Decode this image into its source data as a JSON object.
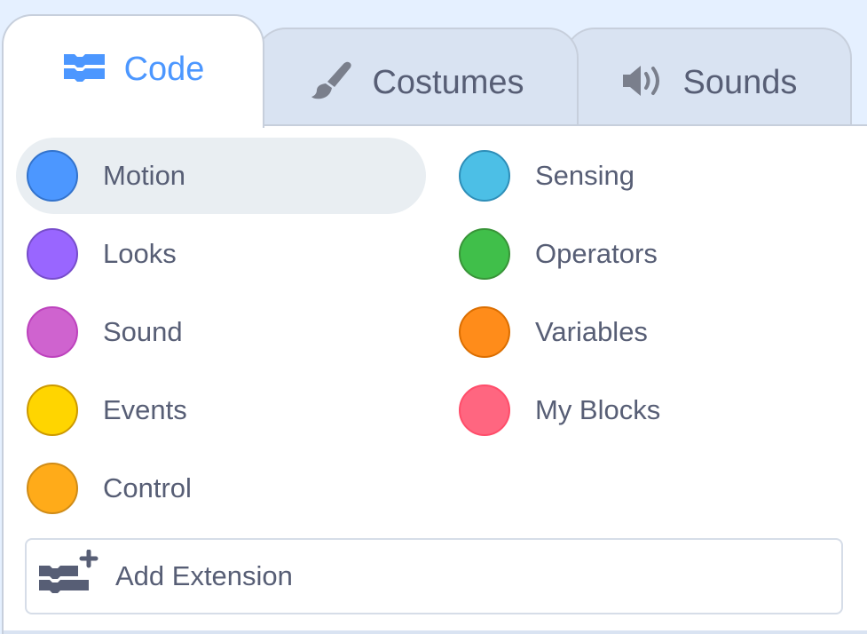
{
  "tabs": {
    "code": "Code",
    "costumes": "Costumes",
    "sounds": "Sounds"
  },
  "categories": [
    {
      "label": "Motion",
      "color": "#4c97ff",
      "border": "#3373cc",
      "selected": true
    },
    {
      "label": "Looks",
      "color": "#9966ff",
      "border": "#774dcb",
      "selected": false
    },
    {
      "label": "Sound",
      "color": "#cf63cf",
      "border": "#bd42bd",
      "selected": false
    },
    {
      "label": "Events",
      "color": "#ffd500",
      "border": "#cc9900",
      "selected": false
    },
    {
      "label": "Control",
      "color": "#ffab19",
      "border": "#cf8b17",
      "selected": false
    },
    {
      "label": "Sensing",
      "color": "#4cbfe6",
      "border": "#2e8eb8",
      "selected": false
    },
    {
      "label": "Operators",
      "color": "#40bf4a",
      "border": "#389438",
      "selected": false
    },
    {
      "label": "Variables",
      "color": "#ff8c1a",
      "border": "#db6e00",
      "selected": false
    },
    {
      "label": "My Blocks",
      "color": "#ff6680",
      "border": "#ff4d6a",
      "selected": false
    }
  ],
  "add_extension": {
    "label": "Add Extension"
  }
}
